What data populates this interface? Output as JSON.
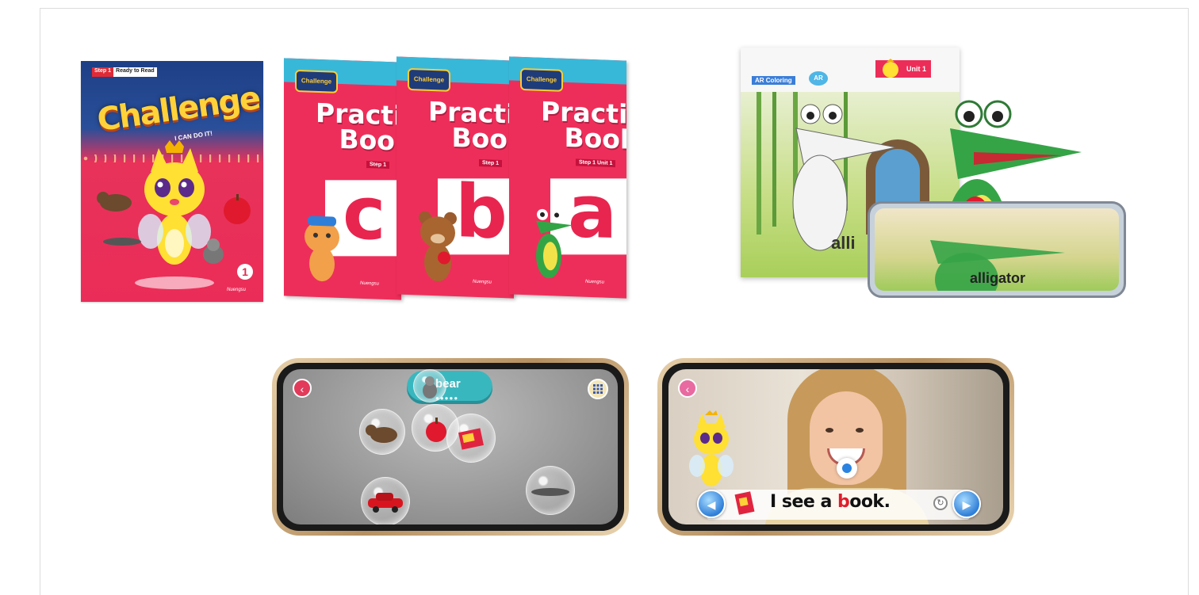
{
  "student_book": {
    "badge_step": "Step 1",
    "badge_label": "Ready to Read",
    "title": "Challenge",
    "subtitle": "I CAN DO IT!",
    "number": "1",
    "publisher": "Nuengsu"
  },
  "practice_books": [
    {
      "title_line1": "Practice",
      "title_line2": "Book",
      "step": "Step 1",
      "letter": "c",
      "logo": "Challenge",
      "brand": "Nuengsu"
    },
    {
      "title_line1": "Practice",
      "title_line2": "Book",
      "step": "Step 1",
      "letter": "b",
      "logo": "Challenge",
      "brand": "Nuengsu"
    },
    {
      "title_line1": "Practice",
      "title_line2": "Book",
      "step": "Step 1 Unit 1",
      "letter": "a",
      "logo": "Challenge",
      "brand": "Nuengsu"
    }
  ],
  "ar_sheet": {
    "label": "AR Coloring",
    "ar_badge": "AR",
    "unit": "Unit 1",
    "word_partial": "alli"
  },
  "ar_phone": {
    "word": "alligator"
  },
  "game_phone": {
    "word": "bear",
    "back_icon": "back-arrow-icon",
    "menu_icon": "grid-menu-icon",
    "bubbles": [
      "bear",
      "apple",
      "book",
      "car",
      "alligator"
    ]
  },
  "reading_phone": {
    "sentence_before": "I see a ",
    "sentence_highlight": "b",
    "sentence_after": "ook.",
    "back_icon": "back-arrow-icon",
    "prev_icon": "prev-arrow-icon",
    "next_icon": "next-arrow-icon",
    "replay_icon": "replay-icon"
  },
  "colors": {
    "brand_pink": "#ee2e5a",
    "brand_blue": "#1d3f86",
    "teal": "#38b8d9",
    "button_blue": "#2f7fd8",
    "gold_frame": "#b58f5f"
  }
}
